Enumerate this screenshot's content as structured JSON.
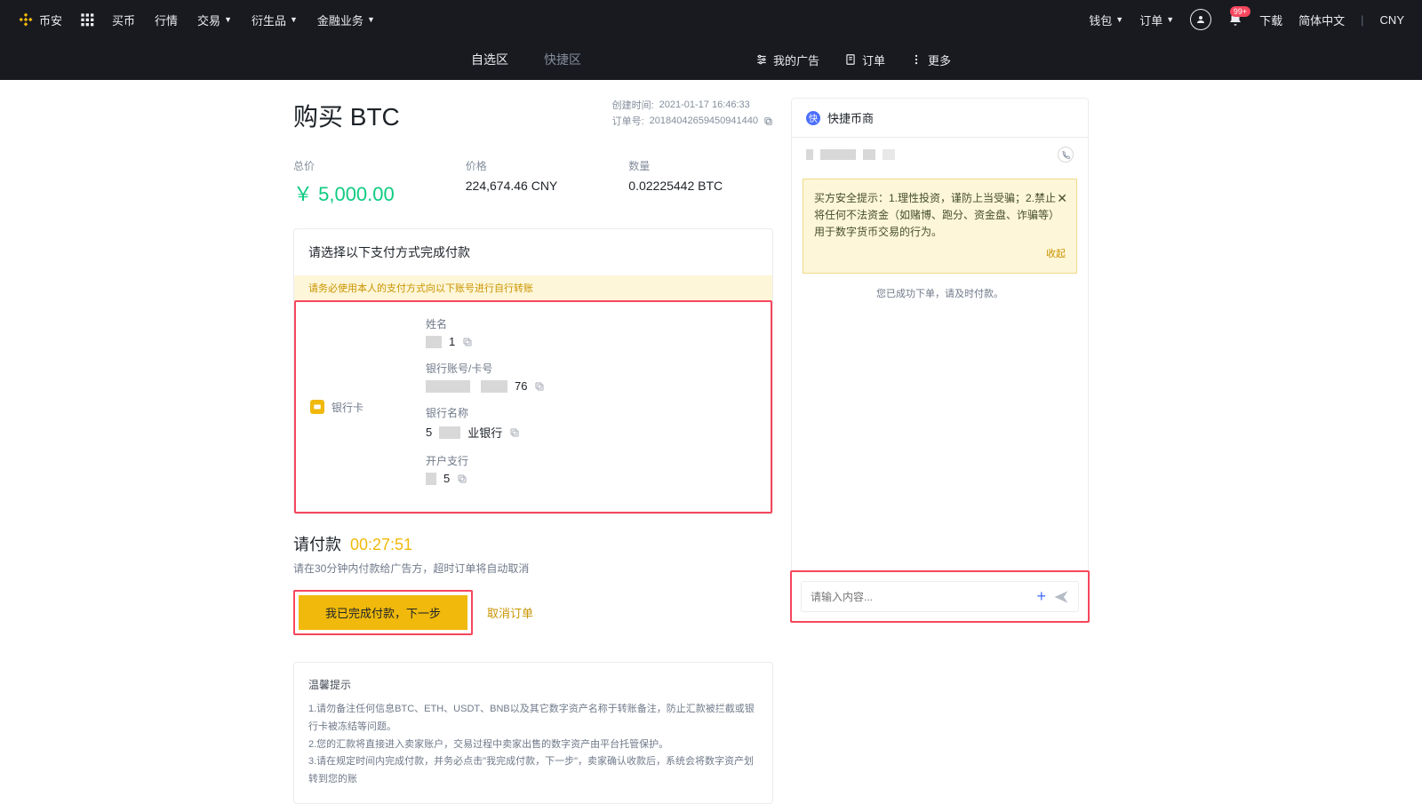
{
  "topnav": {
    "brand": "币安",
    "items": [
      "买币",
      "行情",
      "交易",
      "衍生品",
      "金融业务"
    ],
    "right": {
      "wallet": "钱包",
      "orders": "订单",
      "download": "下载",
      "lang": "简体中文",
      "currency": "CNY",
      "badge": "99+"
    }
  },
  "subnav": {
    "tabs": [
      "自选区",
      "快捷区"
    ],
    "actions": {
      "ads": "我的广告",
      "orders": "订单",
      "more": "更多"
    }
  },
  "order": {
    "title": "购买 BTC",
    "created_label": "创建时间:",
    "created_value": "2021-01-17 16:46:33",
    "orderno_label": "订单号:",
    "orderno_value": "20184042659450941440"
  },
  "prices": {
    "total_label": "总价",
    "total_value": "￥ 5,000.00",
    "price_label": "价格",
    "price_value": "224,674.46 CNY",
    "qty_label": "数量",
    "qty_value": "0.02225442 BTC"
  },
  "payment": {
    "head": "请选择以下支付方式完成付款",
    "warn": "请务必使用本人的支付方式向以下账号进行自行转账",
    "method": "银行卡",
    "fields": {
      "name_label": "姓名",
      "name_suffix": "1",
      "account_label": "银行账号/卡号",
      "account_suffix": "76",
      "bank_label": "银行名称",
      "bank_prefix": "5",
      "bank_suffix": "业银行",
      "branch_label": "开户支行",
      "branch_suffix": "5"
    }
  },
  "countdown": {
    "label": "请付款",
    "time": "00:27:51",
    "note": "请在30分钟内付款给广告方，超时订单将自动取消",
    "btn_primary": "我已完成付款，下一步",
    "btn_cancel": "取消订单"
  },
  "tips": {
    "title": "温馨提示",
    "t1": "1.请勿备注任何信息BTC、ETH、USDT、BNB以及其它数字资产名称于转账备注，防止汇款被拦截或银行卡被冻结等问题。",
    "t2": "2.您的汇款将直接进入卖家账户，交易过程中卖家出售的数字资产由平台托管保护。",
    "t3": "3.请在规定时间内完成付款，并务必点击\"我完成付款，下一步\"，卖家确认收款后，系统会将数字资产划转到您的账"
  },
  "merchant": {
    "title": "快捷币商",
    "alert": "买方安全提示：1.理性投资，谨防上当受骗；2.禁止将任何不法资金（如赌博、跑分、资金盘、诈骗等）用于数字货币交易的行为。",
    "collapse": "收起",
    "status": "您已成功下单，请及时付款。",
    "input_placeholder": "请输入内容..."
  }
}
